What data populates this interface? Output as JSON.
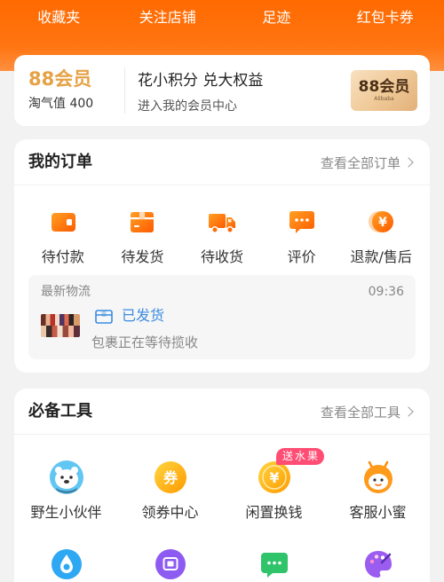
{
  "colors": {
    "brand_orange": "#ff6a00",
    "page_background": "#f2f2f2",
    "member_gold": "#e6a245",
    "logistics_blue": "#3a8be0",
    "badge_pink": "#ff4d73"
  },
  "header": {
    "items": [
      {
        "label": "收藏夹"
      },
      {
        "label": "关注店铺"
      },
      {
        "label": "足迹"
      },
      {
        "label": "红包卡券"
      }
    ]
  },
  "member": {
    "logo_text": "88会员",
    "score_label": "淘气值",
    "score_value": "400",
    "headline": "花小积分 兑大权益",
    "subline": "进入我的会员中心",
    "badge_text": "88会员",
    "badge_subtext": "Alibaba"
  },
  "orders": {
    "title": "我的订单",
    "view_all": "查看全部订单",
    "items": [
      {
        "label": "待付款",
        "icon": "wallet-icon"
      },
      {
        "label": "待发货",
        "icon": "package-icon"
      },
      {
        "label": "待收货",
        "icon": "truck-icon"
      },
      {
        "label": "评价",
        "icon": "comment-icon"
      },
      {
        "label": "退款/售后",
        "icon": "refund-icon",
        "icon_text": "¥"
      }
    ],
    "logistics": {
      "label": "最新物流",
      "time": "09:36",
      "status": "已发货",
      "status_icon": "package-outline-icon",
      "detail": "包裹正在等待揽收"
    }
  },
  "tools": {
    "title": "必备工具",
    "view_all": "查看全部工具",
    "items": [
      {
        "label": "野生小伙伴",
        "icon": "polar-bear-icon"
      },
      {
        "label": "领券中心",
        "icon": "coupon-icon",
        "icon_text": "券"
      },
      {
        "label": "闲置换钱",
        "icon": "coin-icon",
        "icon_text": "¥",
        "badge": "送水果"
      },
      {
        "label": "客服小蜜",
        "icon": "assistant-icon"
      }
    ],
    "more_icons": [
      {
        "icon": "water-drop-icon"
      },
      {
        "icon": "screen-icon"
      },
      {
        "icon": "message-icon"
      },
      {
        "icon": "palette-icon"
      }
    ]
  }
}
